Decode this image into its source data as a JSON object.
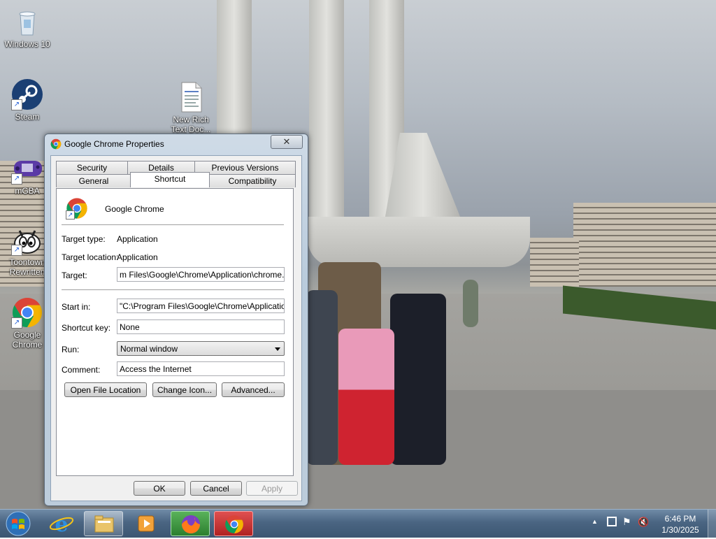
{
  "desktop": {
    "icons": [
      {
        "label": "Windows 10"
      },
      {
        "label": "Steam"
      },
      {
        "label": "New Rich Text Doc..."
      },
      {
        "label": "mGBA"
      },
      {
        "label": "Toontown Rewritten"
      },
      {
        "label": "Google Chrome"
      }
    ]
  },
  "dialog": {
    "title": "Google Chrome Properties",
    "close_glyph": "✕",
    "tabs_row1": [
      "Security",
      "Details",
      "Previous Versions"
    ],
    "tabs_row2": [
      "General",
      "Shortcut",
      "Compatibility"
    ],
    "active_tab": "Shortcut",
    "app_name": "Google Chrome",
    "fields": {
      "target_type_label": "Target type:",
      "target_type_value": "Application",
      "target_location_label": "Target location:",
      "target_location_value": "Application",
      "target_label": "Target:",
      "target_value": "m Files\\Google\\Chrome\\Application\\chrome.exe\"",
      "start_in_label": "Start in:",
      "start_in_value": "\"C:\\Program Files\\Google\\Chrome\\Application\"",
      "shortcut_key_label": "Shortcut key:",
      "shortcut_key_value": "None",
      "run_label": "Run:",
      "run_value": "Normal window",
      "comment_label": "Comment:",
      "comment_value": "Access the Internet"
    },
    "buttons": {
      "open_file_location": "Open File Location",
      "change_icon": "Change Icon...",
      "advanced": "Advanced...",
      "ok": "OK",
      "cancel": "Cancel",
      "apply": "Apply"
    }
  },
  "taskbar": {
    "items": [
      "start-orb",
      "internet-explorer",
      "file-explorer",
      "media-player",
      "firefox",
      "chrome"
    ],
    "clock_time": "6:46 PM",
    "clock_date": "1/30/2025"
  },
  "colors": {
    "taskbar": "#4a6582",
    "dialog_frame": "#b9cbdc",
    "accent_chrome_red": "#db4437",
    "accent_chrome_green": "#0f9d58",
    "accent_chrome_yellow": "#f4b400",
    "accent_chrome_blue": "#4285f4"
  }
}
